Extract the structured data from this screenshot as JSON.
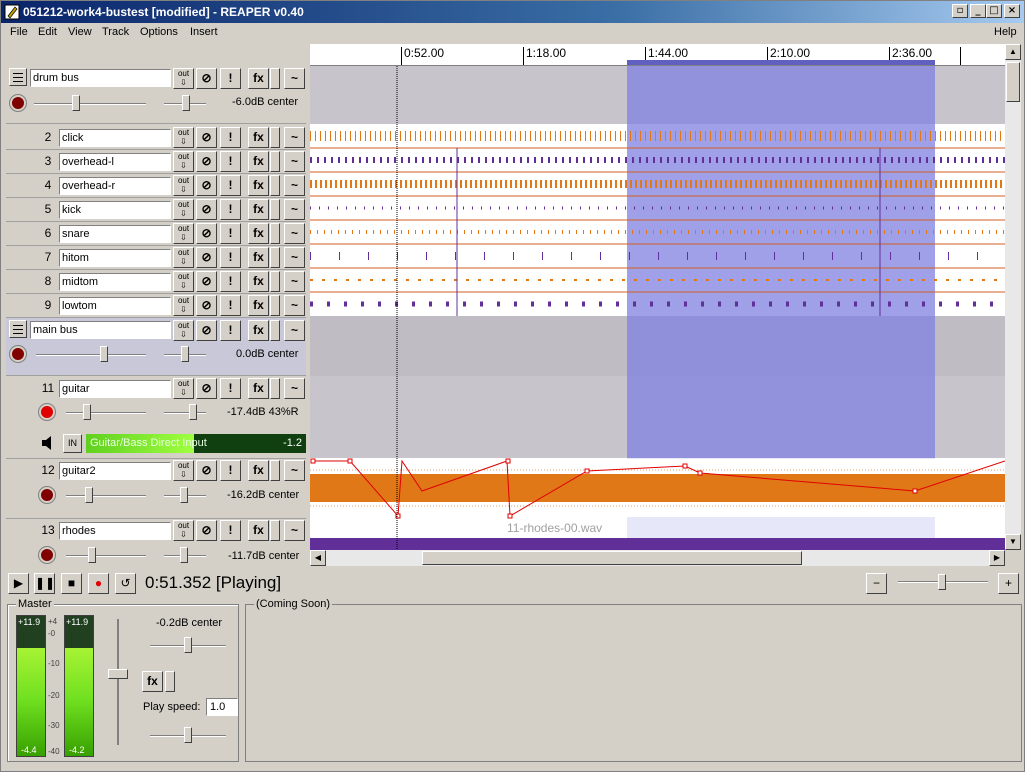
{
  "window": {
    "title": "051212-work4-bustest [modified] - REAPER v0.40"
  },
  "menu": {
    "file": "File",
    "edit": "Edit",
    "view": "View",
    "track": "Track",
    "options": "Options",
    "insert": "Insert",
    "help": "Help"
  },
  "ruler": {
    "marks": [
      "0:52.00",
      "1:18.00",
      "1:44.00",
      "2:10.00",
      "2:36.00"
    ]
  },
  "tracks": [
    {
      "num": "",
      "name": "drum bus",
      "vol": "-6.0dB center",
      "folder": true
    },
    {
      "num": "2",
      "name": "click"
    },
    {
      "num": "3",
      "name": "overhead-l"
    },
    {
      "num": "4",
      "name": "overhead-r"
    },
    {
      "num": "5",
      "name": "kick"
    },
    {
      "num": "6",
      "name": "snare"
    },
    {
      "num": "7",
      "name": "hitom"
    },
    {
      "num": "8",
      "name": "midtom"
    },
    {
      "num": "9",
      "name": "lowtom"
    },
    {
      "num": "",
      "name": "main bus",
      "vol": "0.0dB center",
      "folder": true
    },
    {
      "num": "11",
      "name": "guitar",
      "vol": "-17.4dB 43%R",
      "input": "Guitar/Bass Direct Input",
      "inlevel": "-1.2",
      "inbtn": "IN"
    },
    {
      "num": "12",
      "name": "guitar2",
      "vol": "-16.2dB center"
    },
    {
      "num": "13",
      "name": "rhodes",
      "vol": "-11.7dB center"
    }
  ],
  "buttons": {
    "fx": "fx",
    "phase": "!"
  },
  "items": {
    "rhodes": "11-rhodes-00.wav"
  },
  "transport": {
    "time": "0:51.352 [Playing]"
  },
  "master": {
    "label": "Master",
    "peak_l": "+11.9",
    "peak_r": "+11.9",
    "min_l": "-4.4",
    "min_r": "-4.2",
    "vol": "-0.2dB center",
    "speed_label": "Play speed:",
    "speed": "1.0",
    "fx": "fx",
    "scale": [
      "+4",
      "-0",
      "-10",
      "-20",
      "-30",
      "-40"
    ]
  },
  "coming": {
    "label": "(Coming Soon)"
  },
  "colors": {
    "orange": "#e07818",
    "purple": "#603098",
    "select": "#9898e0",
    "red": "#e00000"
  }
}
